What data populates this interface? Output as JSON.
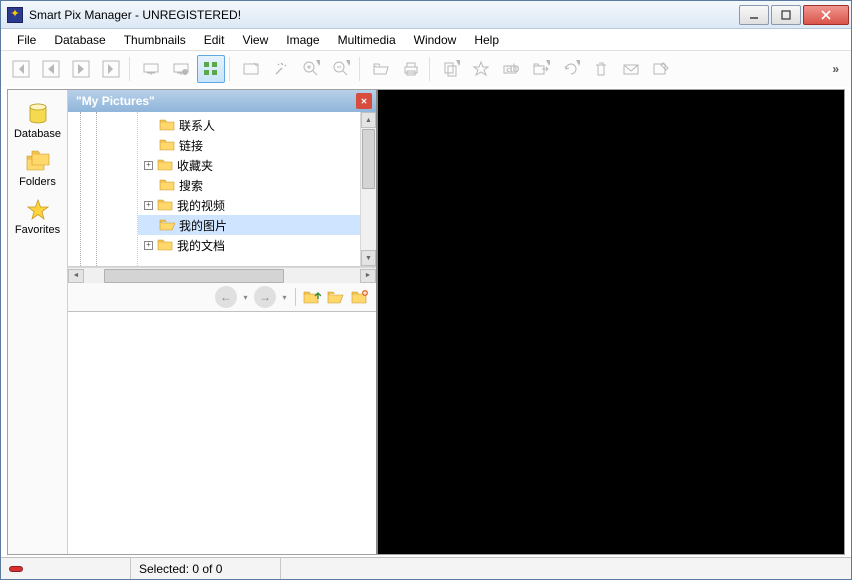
{
  "title": "Smart Pix Manager - UNREGISTERED!",
  "menu": [
    "File",
    "Database",
    "Thumbnails",
    "Edit",
    "View",
    "Image",
    "Multimedia",
    "Window",
    "Help"
  ],
  "nav": {
    "database": "Database",
    "folders": "Folders",
    "favorites": "Favorites"
  },
  "panel": {
    "title": "\"My Pictures\""
  },
  "tree": [
    {
      "label": "联系人",
      "expand": ""
    },
    {
      "label": "链接",
      "expand": ""
    },
    {
      "label": "收藏夹",
      "expand": "+"
    },
    {
      "label": "搜索",
      "expand": ""
    },
    {
      "label": "我的视频",
      "expand": "+"
    },
    {
      "label": "我的图片",
      "expand": "",
      "selected": true
    },
    {
      "label": "我的文档",
      "expand": "+"
    }
  ],
  "status": {
    "selected": "Selected: 0 of 0"
  }
}
